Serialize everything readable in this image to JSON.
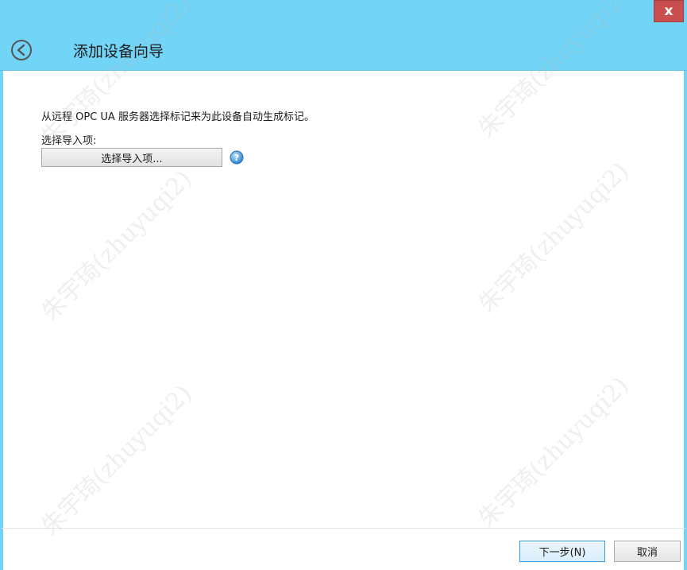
{
  "window": {
    "title": "添加设备向导",
    "close_glyph": "x"
  },
  "content": {
    "description": "从远程 OPC UA 服务器选择标记来为此设备自动生成标记。",
    "import_label": "选择导入项:",
    "import_button": "选择导入项..."
  },
  "footer": {
    "next_label": "下一步(N)",
    "cancel_label": "取消"
  },
  "watermark": {
    "text": "朱宇琦(zhuyuqi2)"
  },
  "colors": {
    "titlebar": "#72d4f7",
    "close": "#c94f4f",
    "accent": "#3c9ad8"
  }
}
